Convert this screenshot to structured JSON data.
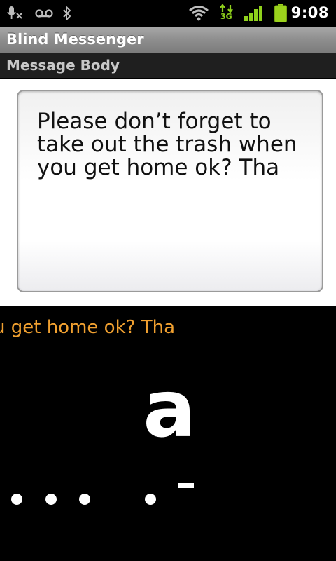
{
  "status_bar": {
    "time": "9:08",
    "network_type": "3G",
    "icons": [
      "mic-muted-icon",
      "voicemail-icon",
      "bluetooth-icon",
      "wifi-icon",
      "data-3g-icon",
      "signal-icon",
      "battery-icon"
    ]
  },
  "app": {
    "title": "Blind Messenger"
  },
  "section": {
    "header": "Message Body"
  },
  "message": {
    "body": "Please don’t forget to take out the trash when you get home ok? Tha"
  },
  "current_line": {
    "text": "u get home ok? Tha"
  },
  "braille": {
    "current_letter": "a"
  },
  "colors": {
    "current_line_text": "#f0a030",
    "network_icon": "#8fd11c",
    "battery": "#9bd21c"
  }
}
